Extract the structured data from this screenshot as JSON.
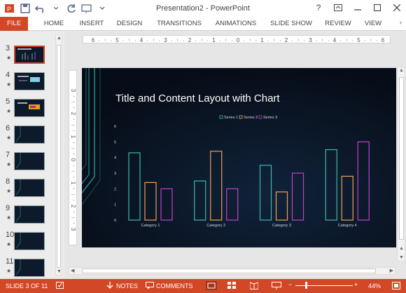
{
  "window": {
    "title": "Presentation2 - PowerPoint",
    "controls": [
      "?",
      "restore-ribbon",
      "minimize",
      "maximize",
      "close"
    ]
  },
  "quick_access": [
    "save-icon",
    "undo-icon",
    "redo-icon",
    "customize-icon"
  ],
  "ribbon": {
    "file": "FILE",
    "tabs": [
      "HOME",
      "INSERT",
      "DESIGN",
      "TRANSITIONS",
      "ANIMATIONS",
      "SLIDE SHOW",
      "REVIEW",
      "VIEW"
    ]
  },
  "thumbnails": [
    {
      "num": "3",
      "star": "★",
      "active": true
    },
    {
      "num": "4",
      "star": "★",
      "active": false
    },
    {
      "num": "5",
      "star": "★",
      "active": false
    },
    {
      "num": "6",
      "star": "★",
      "active": false
    },
    {
      "num": "7",
      "star": "★",
      "active": false
    },
    {
      "num": "8",
      "star": "★",
      "active": false
    },
    {
      "num": "9",
      "star": "★",
      "active": false
    },
    {
      "num": "10",
      "star": "★",
      "active": false
    },
    {
      "num": "11",
      "star": "★",
      "active": false
    }
  ],
  "hruler_labels": [
    "6",
    "5",
    "4",
    "3",
    "2",
    "1",
    "0",
    "1",
    "2",
    "3",
    "4",
    "5",
    "6"
  ],
  "vruler_labels": [
    "3",
    "2",
    "1",
    "0",
    "1",
    "2",
    "3"
  ],
  "slide": {
    "title": "Title and Content Layout with Chart"
  },
  "chart_data": {
    "type": "bar",
    "categories": [
      "Category 1",
      "Category 2",
      "Category 3",
      "Category 4"
    ],
    "series": [
      {
        "name": "Series 1",
        "values": [
          4.3,
          2.5,
          3.5,
          4.5
        ],
        "color": "#3fb8a8"
      },
      {
        "name": "Series 2",
        "values": [
          2.4,
          4.4,
          1.8,
          2.8
        ],
        "color": "#f0a050"
      },
      {
        "name": "Series 3",
        "values": [
          2.0,
          2.0,
          3.0,
          5.0
        ],
        "color": "#c040c8"
      }
    ],
    "ylim": [
      0,
      6
    ],
    "yticks": [
      "0",
      "1",
      "2",
      "3",
      "4",
      "5",
      "6"
    ],
    "legend": "top",
    "grid": false
  },
  "status": {
    "slide_info": "SLIDE 3 OF 11",
    "notes": "NOTES",
    "comments": "COMMENTS",
    "zoom": "44%",
    "zoom_minus": "−",
    "zoom_plus": "+",
    "color": "#d24726"
  }
}
